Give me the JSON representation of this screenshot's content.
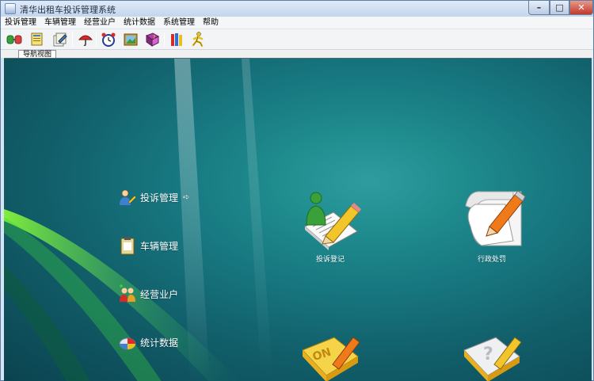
{
  "window": {
    "title": "清华出租车投诉管理系统",
    "controls": {
      "minimize": "–",
      "maximize": "□",
      "close": "✕"
    }
  },
  "menubar": {
    "items": [
      {
        "label": "投诉管理"
      },
      {
        "label": "车辆管理"
      },
      {
        "label": "经营业户"
      },
      {
        "label": "统计数据"
      },
      {
        "label": "系统管理"
      },
      {
        "label": "帮助"
      }
    ]
  },
  "toolbar": {
    "buttons": [
      {
        "icon": "connect-icon"
      },
      {
        "icon": "documents-icon"
      },
      {
        "icon": "edit-documents-icon"
      },
      {
        "icon": "umbrella-icon"
      },
      {
        "icon": "alarm-clock-icon"
      },
      {
        "icon": "picture-icon"
      },
      {
        "icon": "help-book-icon"
      },
      {
        "icon": "books-icon"
      },
      {
        "icon": "exit-runner-icon"
      }
    ]
  },
  "tabs": [
    {
      "label": "导航视图"
    }
  ],
  "navigation": {
    "items": [
      {
        "label": "投诉管理",
        "icon": "user-complaint-icon",
        "active_arrow": "➪"
      },
      {
        "label": "车辆管理",
        "icon": "clipboard-icon"
      },
      {
        "label": "经营业户",
        "icon": "users-group-icon"
      },
      {
        "label": "统计数据",
        "icon": "chart-disc-icon"
      }
    ]
  },
  "functions": {
    "items": [
      {
        "label": "投诉登记",
        "icon": "complaint-register-icon"
      },
      {
        "label": "行政处罚",
        "icon": "penalty-document-icon"
      },
      {
        "label": "",
        "icon": "on-notepad-icon"
      },
      {
        "label": "",
        "icon": "question-notepad-icon"
      }
    ]
  },
  "colors": {
    "desktop": "#177780",
    "menubar": "#f5f6f8",
    "titlebar": "#c4d6ec"
  }
}
